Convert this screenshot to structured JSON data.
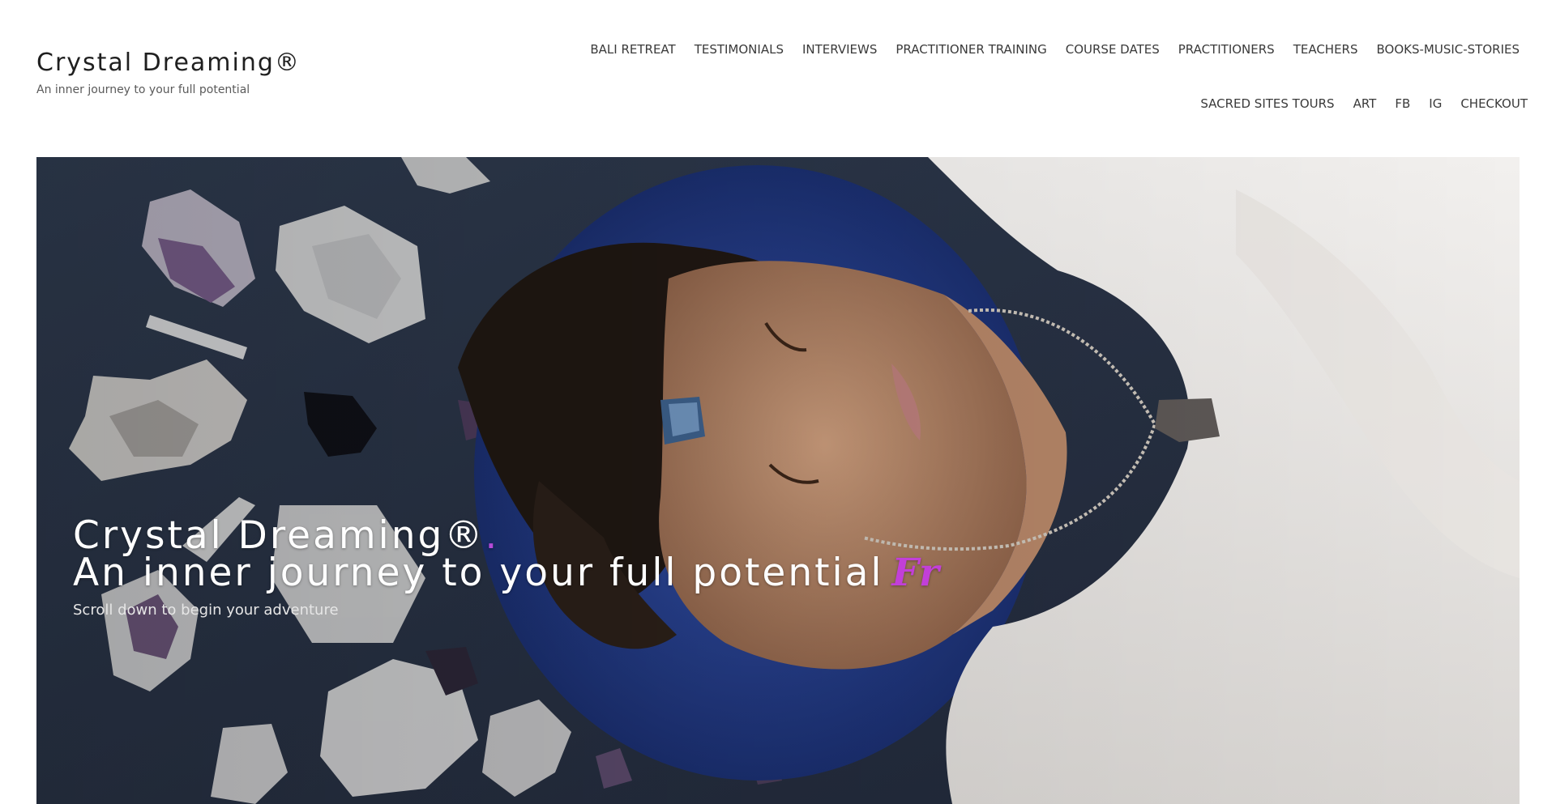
{
  "site": {
    "title": "Crystal Dreaming®",
    "tagline": "An inner journey to your full potential"
  },
  "nav": {
    "row1": [
      "BALI RETREAT",
      "TESTIMONIALS",
      "INTERVIEWS",
      "PRACTITIONER TRAINING",
      "COURSE DATES",
      "PRACTITIONERS",
      "TEACHERS",
      "BOOKS-MUSIC-STORIES"
    ],
    "row2": [
      "SACRED SITES TOURS",
      "ART",
      "FB",
      "IG",
      "CHECKOUT"
    ]
  },
  "hero": {
    "title": "Crystal Dreaming®",
    "title_dot": ".",
    "subtitle": "An inner journey to your full potential",
    "typed": "Fr",
    "scroll_text": "Scroll down to begin your adventure"
  },
  "colors": {
    "accent": "#c23fd8",
    "hero_background": "#2a3547",
    "text": "#333333"
  }
}
